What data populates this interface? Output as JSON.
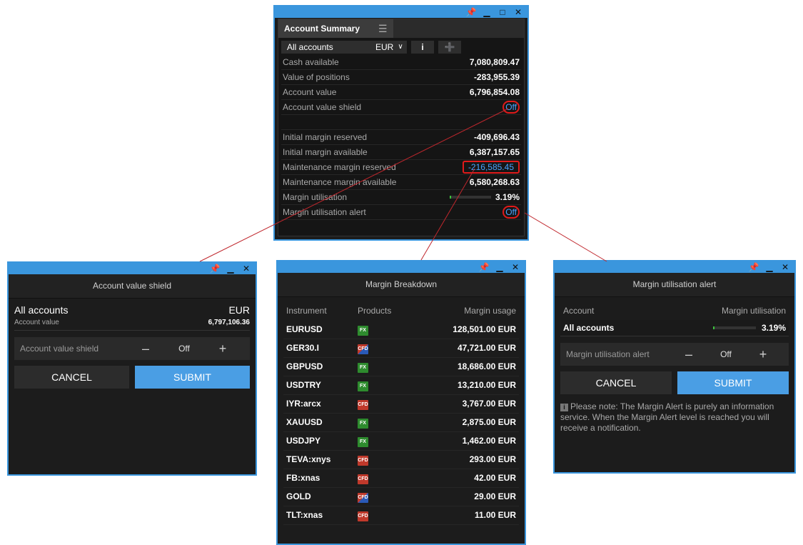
{
  "account_summary": {
    "tab_title": "Account Summary",
    "account_select": "All accounts",
    "currency": "EUR",
    "info_icon": "info-icon",
    "add_icon": "add-list-icon",
    "rows": [
      {
        "label": "Cash available",
        "value": "7,080,809.47"
      },
      {
        "label": "Value of positions",
        "value": "-283,955.39"
      },
      {
        "label": "Account value",
        "value": "6,796,854.08"
      },
      {
        "label": "Account value shield",
        "value": "Off"
      },
      {
        "label": "",
        "value": ""
      },
      {
        "label": "Initial margin reserved",
        "value": "-409,696.43"
      },
      {
        "label": "Initial margin available",
        "value": "6,387,157.65"
      },
      {
        "label": "Maintenance margin reserved",
        "value": "-216,585.45"
      },
      {
        "label": "Maintenance margin available",
        "value": "6,580,268.63"
      },
      {
        "label": "Margin utilisation",
        "value": "3.19%",
        "fraction": 0.0319
      },
      {
        "label": "Margin utilisation alert",
        "value": "Off"
      }
    ]
  },
  "shield_dialog": {
    "title": "Account value shield",
    "account": "All accounts",
    "currency": "EUR",
    "account_value_label": "Account value",
    "account_value": "6,797,106.36",
    "stepper_label": "Account value shield",
    "stepper_value": "Off",
    "cancel": "CANCEL",
    "submit": "SUBMIT"
  },
  "margin_breakdown": {
    "title": "Margin Breakdown",
    "headers": [
      "Instrument",
      "Products",
      "Margin usage"
    ],
    "rows": [
      {
        "instrument": "EURUSD",
        "product": "FX",
        "usage": "128,501.00 EUR"
      },
      {
        "instrument": "GER30.I",
        "product": "CFD",
        "usage": "47,721.00 EUR"
      },
      {
        "instrument": "GBPUSD",
        "product": "FX",
        "usage": "18,686.00 EUR"
      },
      {
        "instrument": "USDTRY",
        "product": "FX",
        "usage": "13,210.00 EUR"
      },
      {
        "instrument": "IYR:arcx",
        "product": "CFD",
        "usage": "3,767.00 EUR"
      },
      {
        "instrument": "XAUUSD",
        "product": "FX",
        "usage": "2,875.00 EUR"
      },
      {
        "instrument": "USDJPY",
        "product": "FX",
        "usage": "1,462.00 EUR"
      },
      {
        "instrument": "TEVA:xnys",
        "product": "CFD",
        "usage": "293.00 EUR"
      },
      {
        "instrument": "FB:xnas",
        "product": "CFD",
        "usage": "42.00 EUR"
      },
      {
        "instrument": "GOLD",
        "product": "CFD",
        "usage": "29.00 EUR"
      },
      {
        "instrument": "TLT:xnas",
        "product": "CFD",
        "usage": "11.00 EUR"
      }
    ]
  },
  "alert_dialog": {
    "title": "Margin utilisation alert",
    "col_account": "Account",
    "col_util": "Margin utilisation",
    "account": "All accounts",
    "util_value": "3.19%",
    "util_fraction": 0.0319,
    "stepper_label": "Margin utilisation alert",
    "stepper_value": "Off",
    "cancel": "CANCEL",
    "submit": "SUBMIT",
    "note": "Please note: The Margin Alert is purely an information service. When the Margin Alert level is reached you will receive a notification."
  },
  "colors": {
    "accent": "#3a96dd",
    "submit": "#4a9ee4",
    "highlight": "#e01a1a",
    "link": "#4aa3ff",
    "fx": "#2e8b2e",
    "cfd": "#c0392b"
  }
}
